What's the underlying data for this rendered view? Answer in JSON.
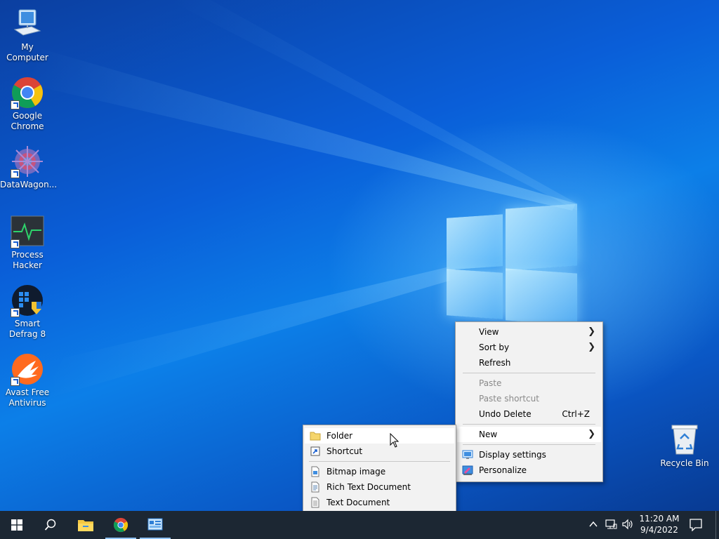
{
  "desktop": {
    "icons": [
      {
        "label": "My Computer",
        "icon": "computer-icon"
      },
      {
        "label": "Google Chrome",
        "icon": "chrome-icon"
      },
      {
        "label": "DataWagon...",
        "icon": "datawagon-icon"
      },
      {
        "label": "Process Hacker",
        "icon": "process-hacker-icon"
      },
      {
        "label": "Smart Defrag 8",
        "icon": "smart-defrag-icon"
      },
      {
        "label": "Avast Free Antivirus",
        "icon": "avast-icon"
      },
      {
        "label": "Recycle Bin",
        "icon": "recycle-bin-icon"
      }
    ]
  },
  "context_menu": {
    "view": "View",
    "sort_by": "Sort by",
    "refresh": "Refresh",
    "paste": "Paste",
    "paste_shortcut": "Paste shortcut",
    "undo_delete": "Undo Delete",
    "undo_shortcut": "Ctrl+Z",
    "new": "New",
    "display_settings": "Display settings",
    "personalize": "Personalize"
  },
  "new_submenu": {
    "folder": "Folder",
    "shortcut": "Shortcut",
    "bitmap": "Bitmap image",
    "rtf": "Rich Text Document",
    "text": "Text Document"
  },
  "taskbar": {
    "apps": [
      "start-icon",
      "search-icon",
      "file-explorer-icon",
      "chrome-icon",
      "control-panel-icon"
    ],
    "time": "11:20 AM",
    "date": "9/4/2022"
  },
  "colors": {
    "taskbar": "#1c2733",
    "menu": "#f2f2f2",
    "accent": "#0a5fc7"
  }
}
